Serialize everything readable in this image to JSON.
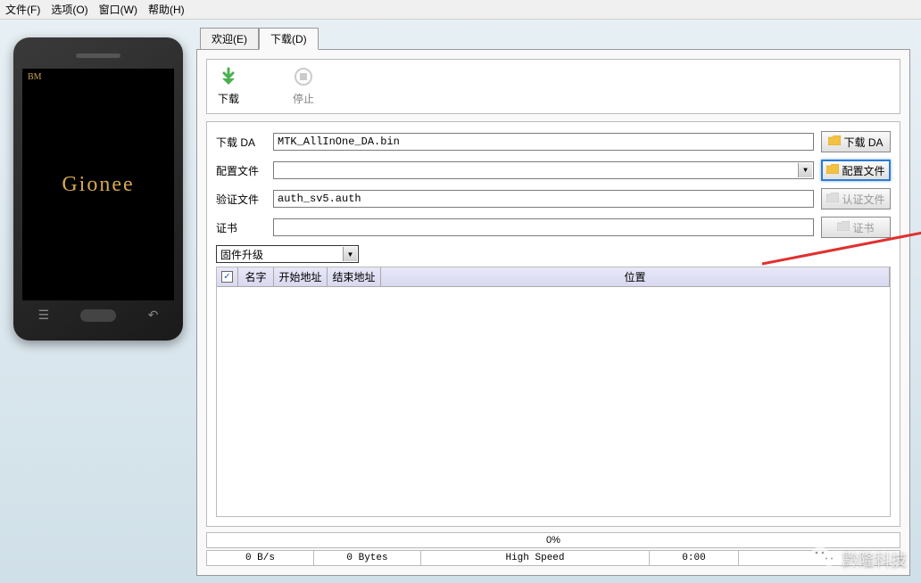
{
  "menubar": {
    "file": "文件(F)",
    "options": "选项(O)",
    "window": "窗口(W)",
    "help": "帮助(H)"
  },
  "phone": {
    "bm": "BM",
    "brand": "Gionee"
  },
  "tabs": {
    "welcome": "欢迎(E)",
    "download": "下载(D)"
  },
  "toolbar": {
    "download": "下载",
    "stop": "停止"
  },
  "form": {
    "da_label": "下载 DA",
    "da_value": "MTK_AllInOne_DA.bin",
    "da_button": "下载 DA",
    "config_label": "配置文件",
    "config_value": "",
    "config_button": "配置文件",
    "auth_label": "验证文件",
    "auth_value": "auth_sv5.auth",
    "auth_button": "认证文件",
    "cert_label": "证书",
    "cert_value": "",
    "cert_button": "证书",
    "action_select": "固件升级"
  },
  "table": {
    "col_name": "名字",
    "col_start": "开始地址",
    "col_end": "结束地址",
    "col_location": "位置"
  },
  "status": {
    "progress": "0%",
    "speed": "0 B/s",
    "bytes": "0 Bytes",
    "mode": "High Speed",
    "time": "0:00"
  },
  "watermark": "黔隆科技"
}
